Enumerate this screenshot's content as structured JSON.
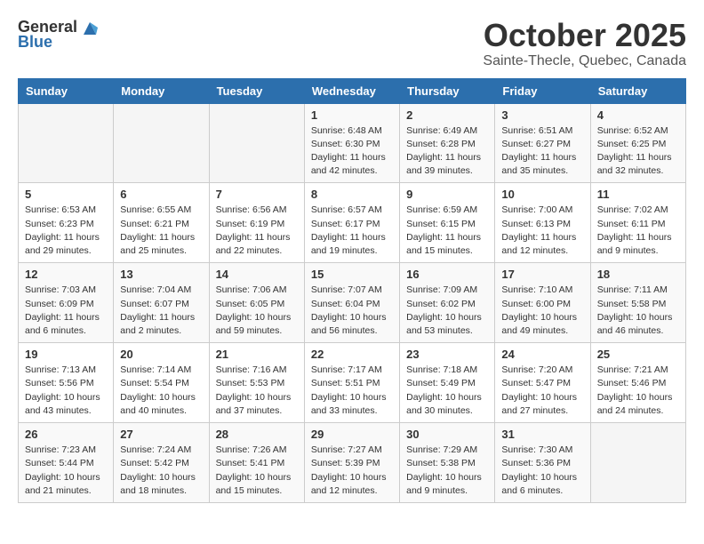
{
  "header": {
    "logo_general": "General",
    "logo_blue": "Blue",
    "month_title": "October 2025",
    "location": "Sainte-Thecle, Quebec, Canada"
  },
  "weekdays": [
    "Sunday",
    "Monday",
    "Tuesday",
    "Wednesday",
    "Thursday",
    "Friday",
    "Saturday"
  ],
  "weeks": [
    [
      {
        "day": "",
        "sunrise": "",
        "sunset": "",
        "daylight": ""
      },
      {
        "day": "",
        "sunrise": "",
        "sunset": "",
        "daylight": ""
      },
      {
        "day": "",
        "sunrise": "",
        "sunset": "",
        "daylight": ""
      },
      {
        "day": "1",
        "sunrise": "Sunrise: 6:48 AM",
        "sunset": "Sunset: 6:30 PM",
        "daylight": "Daylight: 11 hours and 42 minutes."
      },
      {
        "day": "2",
        "sunrise": "Sunrise: 6:49 AM",
        "sunset": "Sunset: 6:28 PM",
        "daylight": "Daylight: 11 hours and 39 minutes."
      },
      {
        "day": "3",
        "sunrise": "Sunrise: 6:51 AM",
        "sunset": "Sunset: 6:27 PM",
        "daylight": "Daylight: 11 hours and 35 minutes."
      },
      {
        "day": "4",
        "sunrise": "Sunrise: 6:52 AM",
        "sunset": "Sunset: 6:25 PM",
        "daylight": "Daylight: 11 hours and 32 minutes."
      }
    ],
    [
      {
        "day": "5",
        "sunrise": "Sunrise: 6:53 AM",
        "sunset": "Sunset: 6:23 PM",
        "daylight": "Daylight: 11 hours and 29 minutes."
      },
      {
        "day": "6",
        "sunrise": "Sunrise: 6:55 AM",
        "sunset": "Sunset: 6:21 PM",
        "daylight": "Daylight: 11 hours and 25 minutes."
      },
      {
        "day": "7",
        "sunrise": "Sunrise: 6:56 AM",
        "sunset": "Sunset: 6:19 PM",
        "daylight": "Daylight: 11 hours and 22 minutes."
      },
      {
        "day": "8",
        "sunrise": "Sunrise: 6:57 AM",
        "sunset": "Sunset: 6:17 PM",
        "daylight": "Daylight: 11 hours and 19 minutes."
      },
      {
        "day": "9",
        "sunrise": "Sunrise: 6:59 AM",
        "sunset": "Sunset: 6:15 PM",
        "daylight": "Daylight: 11 hours and 15 minutes."
      },
      {
        "day": "10",
        "sunrise": "Sunrise: 7:00 AM",
        "sunset": "Sunset: 6:13 PM",
        "daylight": "Daylight: 11 hours and 12 minutes."
      },
      {
        "day": "11",
        "sunrise": "Sunrise: 7:02 AM",
        "sunset": "Sunset: 6:11 PM",
        "daylight": "Daylight: 11 hours and 9 minutes."
      }
    ],
    [
      {
        "day": "12",
        "sunrise": "Sunrise: 7:03 AM",
        "sunset": "Sunset: 6:09 PM",
        "daylight": "Daylight: 11 hours and 6 minutes."
      },
      {
        "day": "13",
        "sunrise": "Sunrise: 7:04 AM",
        "sunset": "Sunset: 6:07 PM",
        "daylight": "Daylight: 11 hours and 2 minutes."
      },
      {
        "day": "14",
        "sunrise": "Sunrise: 7:06 AM",
        "sunset": "Sunset: 6:05 PM",
        "daylight": "Daylight: 10 hours and 59 minutes."
      },
      {
        "day": "15",
        "sunrise": "Sunrise: 7:07 AM",
        "sunset": "Sunset: 6:04 PM",
        "daylight": "Daylight: 10 hours and 56 minutes."
      },
      {
        "day": "16",
        "sunrise": "Sunrise: 7:09 AM",
        "sunset": "Sunset: 6:02 PM",
        "daylight": "Daylight: 10 hours and 53 minutes."
      },
      {
        "day": "17",
        "sunrise": "Sunrise: 7:10 AM",
        "sunset": "Sunset: 6:00 PM",
        "daylight": "Daylight: 10 hours and 49 minutes."
      },
      {
        "day": "18",
        "sunrise": "Sunrise: 7:11 AM",
        "sunset": "Sunset: 5:58 PM",
        "daylight": "Daylight: 10 hours and 46 minutes."
      }
    ],
    [
      {
        "day": "19",
        "sunrise": "Sunrise: 7:13 AM",
        "sunset": "Sunset: 5:56 PM",
        "daylight": "Daylight: 10 hours and 43 minutes."
      },
      {
        "day": "20",
        "sunrise": "Sunrise: 7:14 AM",
        "sunset": "Sunset: 5:54 PM",
        "daylight": "Daylight: 10 hours and 40 minutes."
      },
      {
        "day": "21",
        "sunrise": "Sunrise: 7:16 AM",
        "sunset": "Sunset: 5:53 PM",
        "daylight": "Daylight: 10 hours and 37 minutes."
      },
      {
        "day": "22",
        "sunrise": "Sunrise: 7:17 AM",
        "sunset": "Sunset: 5:51 PM",
        "daylight": "Daylight: 10 hours and 33 minutes."
      },
      {
        "day": "23",
        "sunrise": "Sunrise: 7:18 AM",
        "sunset": "Sunset: 5:49 PM",
        "daylight": "Daylight: 10 hours and 30 minutes."
      },
      {
        "day": "24",
        "sunrise": "Sunrise: 7:20 AM",
        "sunset": "Sunset: 5:47 PM",
        "daylight": "Daylight: 10 hours and 27 minutes."
      },
      {
        "day": "25",
        "sunrise": "Sunrise: 7:21 AM",
        "sunset": "Sunset: 5:46 PM",
        "daylight": "Daylight: 10 hours and 24 minutes."
      }
    ],
    [
      {
        "day": "26",
        "sunrise": "Sunrise: 7:23 AM",
        "sunset": "Sunset: 5:44 PM",
        "daylight": "Daylight: 10 hours and 21 minutes."
      },
      {
        "day": "27",
        "sunrise": "Sunrise: 7:24 AM",
        "sunset": "Sunset: 5:42 PM",
        "daylight": "Daylight: 10 hours and 18 minutes."
      },
      {
        "day": "28",
        "sunrise": "Sunrise: 7:26 AM",
        "sunset": "Sunset: 5:41 PM",
        "daylight": "Daylight: 10 hours and 15 minutes."
      },
      {
        "day": "29",
        "sunrise": "Sunrise: 7:27 AM",
        "sunset": "Sunset: 5:39 PM",
        "daylight": "Daylight: 10 hours and 12 minutes."
      },
      {
        "day": "30",
        "sunrise": "Sunrise: 7:29 AM",
        "sunset": "Sunset: 5:38 PM",
        "daylight": "Daylight: 10 hours and 9 minutes."
      },
      {
        "day": "31",
        "sunrise": "Sunrise: 7:30 AM",
        "sunset": "Sunset: 5:36 PM",
        "daylight": "Daylight: 10 hours and 6 minutes."
      },
      {
        "day": "",
        "sunrise": "",
        "sunset": "",
        "daylight": ""
      }
    ]
  ]
}
